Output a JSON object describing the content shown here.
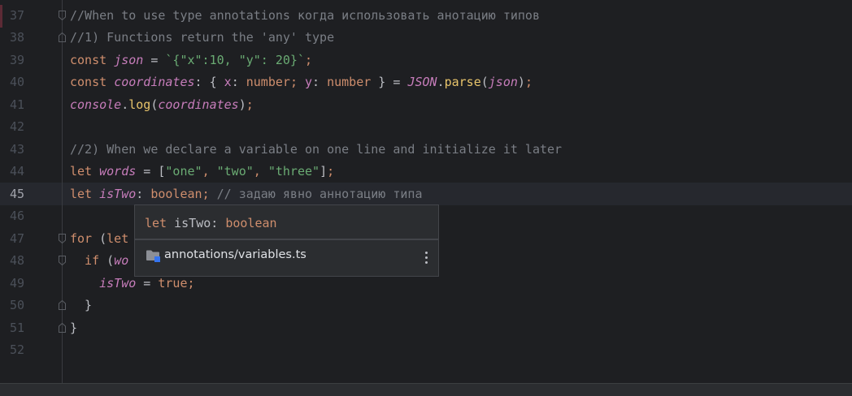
{
  "editor": {
    "lines": [
      {
        "num": "37",
        "tokens": [
          {
            "t": "//When to use type annotations когда использовать анотацию типов",
            "c": "comment"
          }
        ]
      },
      {
        "num": "38",
        "tokens": [
          {
            "t": "//1) Functions return the 'any' type",
            "c": "comment"
          }
        ]
      },
      {
        "num": "39",
        "tokens": [
          {
            "t": "const ",
            "c": "keyword"
          },
          {
            "t": "json",
            "c": "var"
          },
          {
            "t": " = ",
            "c": "plain"
          },
          {
            "t": "`{\"x\":10, \"y\": 20}`",
            "c": "string"
          },
          {
            "t": ";",
            "c": "keyword"
          }
        ]
      },
      {
        "num": "40",
        "tokens": [
          {
            "t": "const ",
            "c": "keyword"
          },
          {
            "t": "coordinates",
            "c": "var"
          },
          {
            "t": ": { ",
            "c": "plain"
          },
          {
            "t": "x",
            "c": "prop"
          },
          {
            "t": ": ",
            "c": "plain"
          },
          {
            "t": "number",
            "c": "keyword"
          },
          {
            "t": "; ",
            "c": "keyword"
          },
          {
            "t": "y",
            "c": "prop"
          },
          {
            "t": ": ",
            "c": "plain"
          },
          {
            "t": "number",
            "c": "keyword"
          },
          {
            "t": " } = ",
            "c": "plain"
          },
          {
            "t": "JSON",
            "c": "builtin"
          },
          {
            "t": ".",
            "c": "plain"
          },
          {
            "t": "parse",
            "c": "method"
          },
          {
            "t": "(",
            "c": "plain"
          },
          {
            "t": "json",
            "c": "var"
          },
          {
            "t": ")",
            "c": "plain"
          },
          {
            "t": ";",
            "c": "keyword"
          }
        ]
      },
      {
        "num": "41",
        "tokens": [
          {
            "t": "console",
            "c": "builtin"
          },
          {
            "t": ".",
            "c": "plain"
          },
          {
            "t": "log",
            "c": "method"
          },
          {
            "t": "(",
            "c": "plain"
          },
          {
            "t": "coordinates",
            "c": "var"
          },
          {
            "t": ")",
            "c": "plain"
          },
          {
            "t": ";",
            "c": "keyword"
          }
        ]
      },
      {
        "num": "42",
        "tokens": []
      },
      {
        "num": "43",
        "tokens": [
          {
            "t": "//2) When we declare a variable on one line and initialize it later",
            "c": "comment"
          }
        ]
      },
      {
        "num": "44",
        "tokens": [
          {
            "t": "let ",
            "c": "keyword"
          },
          {
            "t": "words",
            "c": "var"
          },
          {
            "t": " = [",
            "c": "plain"
          },
          {
            "t": "\"one\"",
            "c": "string"
          },
          {
            "t": ", ",
            "c": "keyword"
          },
          {
            "t": "\"two\"",
            "c": "string"
          },
          {
            "t": ", ",
            "c": "keyword"
          },
          {
            "t": "\"three\"",
            "c": "string"
          },
          {
            "t": "]",
            "c": "plain"
          },
          {
            "t": ";",
            "c": "keyword"
          }
        ]
      },
      {
        "num": "45",
        "tokens": [
          {
            "t": "let ",
            "c": "keyword"
          },
          {
            "t": "isTwo",
            "c": "var"
          },
          {
            "t": ": ",
            "c": "plain"
          },
          {
            "t": "boolean",
            "c": "keyword"
          },
          {
            "t": "; ",
            "c": "keyword"
          },
          {
            "t": "// задаю явно аннотацию типа",
            "c": "comment"
          }
        ]
      },
      {
        "num": "46",
        "tokens": []
      },
      {
        "num": "47",
        "tokens": [
          {
            "t": "for ",
            "c": "keyword"
          },
          {
            "t": "(",
            "c": "plain"
          },
          {
            "t": "let",
            "c": "keyword"
          }
        ]
      },
      {
        "num": "48",
        "tokens": [
          {
            "t": "  if ",
            "c": "keyword"
          },
          {
            "t": "(",
            "c": "plain"
          },
          {
            "t": "wo",
            "c": "var"
          }
        ]
      },
      {
        "num": "49",
        "tokens": [
          {
            "t": "    ",
            "c": "plain"
          },
          {
            "t": "isTwo",
            "c": "var"
          },
          {
            "t": " = ",
            "c": "plain"
          },
          {
            "t": "true",
            "c": "keyword"
          },
          {
            "t": ";",
            "c": "keyword"
          }
        ]
      },
      {
        "num": "50",
        "tokens": [
          {
            "t": "  }",
            "c": "plain"
          }
        ]
      },
      {
        "num": "51",
        "tokens": [
          {
            "t": "}",
            "c": "plain"
          }
        ]
      },
      {
        "num": "52",
        "tokens": []
      }
    ],
    "current_line": "45"
  },
  "popup": {
    "sig_keyword": "let ",
    "sig_name": "isTwo",
    "sig_colon": ": ",
    "sig_type": "boolean",
    "path": "annotations/variables.ts"
  },
  "icons": {
    "folder": "folder-icon",
    "more": "more-vertical-icon",
    "fold": "fold-marker-icon"
  },
  "colors": {
    "background": "#1e1f22",
    "keyword": "#cf8e6d",
    "comment": "#7a7e85",
    "string": "#6aab73",
    "variable": "#c77dbb",
    "method": "#e8c46b",
    "folder_badge": "#3574f0"
  }
}
